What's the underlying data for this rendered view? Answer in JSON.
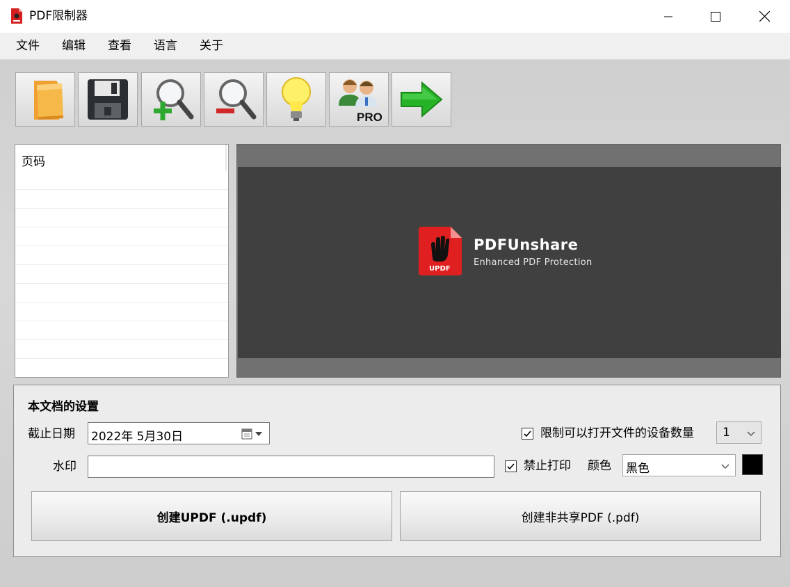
{
  "window": {
    "title": "PDF限制器"
  },
  "menu": {
    "items": [
      "文件",
      "编辑",
      "查看",
      "语言",
      "关于"
    ]
  },
  "toolbar": {
    "buttons": [
      {
        "name": "open-folder-icon"
      },
      {
        "name": "save-floppy-icon"
      },
      {
        "name": "zoom-in-icon"
      },
      {
        "name": "zoom-out-icon"
      },
      {
        "name": "lightbulb-icon"
      },
      {
        "name": "pro-users-icon",
        "badge": "PRO"
      },
      {
        "name": "next-arrow-icon"
      }
    ]
  },
  "pagelist": {
    "header": "页码"
  },
  "preview": {
    "logo_badge": "UPDF",
    "logo_title": "PDFUnshare",
    "logo_subtitle": "Enhanced PDF Protection"
  },
  "settings": {
    "title": "本文档的设置",
    "expiry_label": "截止日期",
    "expiry_value": "2022年  5月30日",
    "device_limit_label": "限制可以打开文件的设备数量",
    "device_limit_checked": true,
    "device_count": "1",
    "watermark_label": "水印",
    "watermark_value": "",
    "no_print_label": "禁止打印",
    "no_print_checked": true,
    "color_label": "颜色",
    "color_value": "黑色",
    "color_swatch": "#000000",
    "create_updf_label": "创建UPDF (.updf)",
    "create_pdf_label": "创建非共享PDF (.pdf)"
  },
  "colors": {
    "accent_red": "#e02020",
    "arrow_green": "#27b327"
  }
}
